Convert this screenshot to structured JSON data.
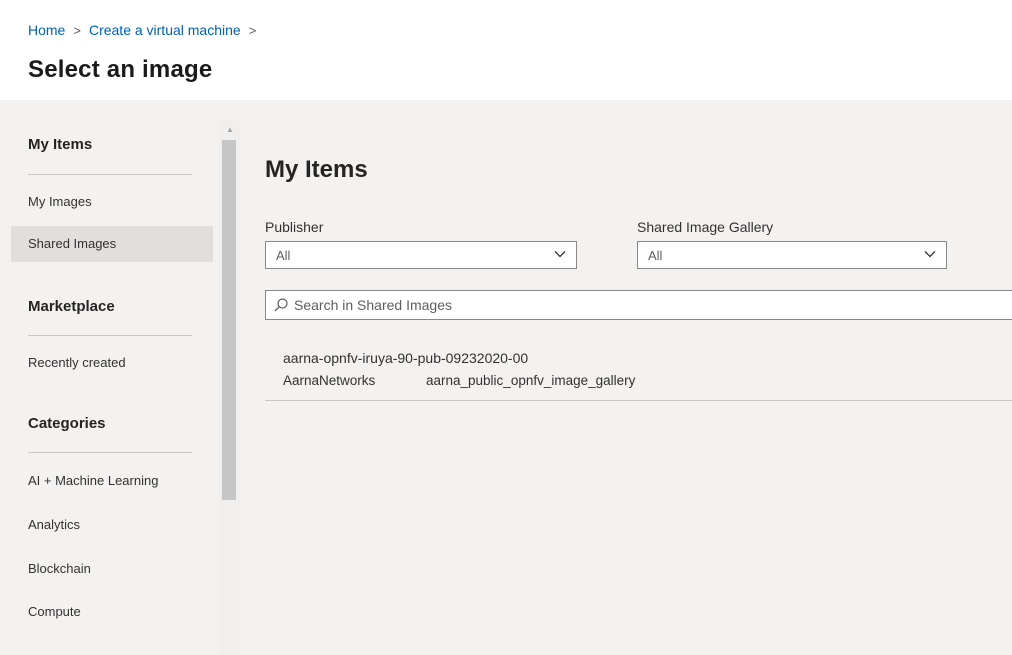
{
  "breadcrumb": {
    "home": "Home",
    "create_vm": "Create a virtual machine",
    "separator": ">"
  },
  "page_title": "Select an image",
  "sidebar": {
    "my_items_heading": "My Items",
    "my_items": [
      {
        "label": "My Images",
        "selected": false
      },
      {
        "label": "Shared Images",
        "selected": true
      }
    ],
    "marketplace_heading": "Marketplace",
    "marketplace_items": [
      {
        "label": "Recently created"
      }
    ],
    "categories_heading": "Categories",
    "categories": [
      {
        "label": "AI + Machine Learning"
      },
      {
        "label": "Analytics"
      },
      {
        "label": "Blockchain"
      },
      {
        "label": "Compute"
      }
    ]
  },
  "main": {
    "heading": "My Items",
    "publisher": {
      "label": "Publisher",
      "value": "All"
    },
    "gallery": {
      "label": "Shared Image Gallery",
      "value": "All"
    },
    "search": {
      "placeholder": "Search in Shared Images",
      "value": ""
    },
    "results": [
      {
        "name": "aarna-opnfv-iruya-90-pub-09232020-00",
        "publisher": "AarnaNetworks",
        "gallery": "aarna_public_opnfv_image_gallery"
      }
    ]
  },
  "colors": {
    "link": "#0062ad",
    "panel_background": "#f3f2f1",
    "selected_item": "#e1dfdd"
  },
  "icons": {
    "breadcrumb_separator": "chevron-right-icon",
    "dropdown": "chevron-down-icon",
    "search": "search-icon",
    "scroll_up": "triangle-up-icon"
  }
}
